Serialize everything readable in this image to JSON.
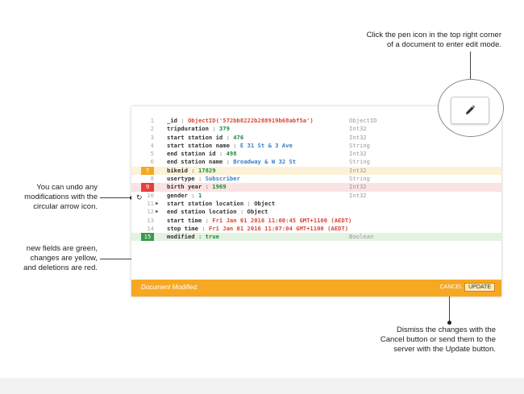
{
  "annotations": {
    "pen_tip": [
      "Click the pen icon in the top right corner",
      "of a document to enter edit mode."
    ],
    "undo_tip": [
      "You can undo any",
      "modifications with the",
      "circular arrow icon."
    ],
    "colors_tip": [
      "new fields are green,",
      "changes are yellow,",
      "and deletions are red."
    ],
    "buttons_tip": [
      "Dismiss the changes with the",
      "Cancel button or send them to the",
      "server with the Update button."
    ]
  },
  "document": {
    "rows": [
      {
        "line": "1",
        "key": "_id",
        "value": "ObjectID('572bb8222b288919b68abf5a')",
        "value_color": "red",
        "type": "ObjectID",
        "state": ""
      },
      {
        "line": "2",
        "key": "tripduration",
        "value": "379",
        "value_color": "green",
        "type": "Int32",
        "state": ""
      },
      {
        "line": "3",
        "key": "start station id",
        "value": "476",
        "value_color": "green",
        "type": "Int32",
        "state": ""
      },
      {
        "line": "4",
        "key": "start station name",
        "value": "E 31 St & 3 Ave",
        "value_color": "blue",
        "type": "String",
        "state": ""
      },
      {
        "line": "5",
        "key": "end station id",
        "value": "498",
        "value_color": "green",
        "type": "Int32",
        "state": ""
      },
      {
        "line": "6",
        "key": "end station name",
        "value": "Broadway & W 32 St",
        "value_color": "blue",
        "type": "String",
        "state": ""
      },
      {
        "line": "7",
        "key": "bikeid",
        "value": "17829",
        "value_color": "green",
        "type": "Int32",
        "state": "edited"
      },
      {
        "line": "8",
        "key": "usertype",
        "value": "Subscriber",
        "value_color": "blue",
        "type": "String",
        "state": ""
      },
      {
        "line": "9",
        "key": "birth year",
        "value": "1969",
        "value_color": "green",
        "type": "Int32",
        "state": "deleted"
      },
      {
        "line": "10",
        "key": "gender",
        "value": "1",
        "value_color": "green",
        "type": "Int32",
        "state": ""
      },
      {
        "line": "11",
        "key": "start station location",
        "value": "Object",
        "value_color": "plain",
        "type": "",
        "state": "",
        "expander": "▶"
      },
      {
        "line": "12",
        "key": "end station location",
        "value": "Object",
        "value_color": "plain",
        "type": "",
        "state": "",
        "expander": "▶"
      },
      {
        "line": "13",
        "key": "start time",
        "value": "Fri Jan 01 2016 11:00:45 GMT+1100 (AEDT)",
        "value_color": "red",
        "type": "",
        "state": ""
      },
      {
        "line": "14",
        "key": "stop time",
        "value": "Fri Jan 01 2016 11:07:04 GMT+1100 (AEDT)",
        "value_color": "red",
        "type": "",
        "state": ""
      },
      {
        "line": "15",
        "key": "modified",
        "value": "true",
        "value_color": "green",
        "type": "Boolean",
        "state": "added"
      }
    ],
    "footer": {
      "message": "Document Modified.",
      "cancel_label": "CANCEL",
      "update_label": "UPDATE"
    }
  },
  "icons": {
    "edit": "pen-icon",
    "undo": "undo-arrow-icon"
  },
  "colors": {
    "modified": "#f7a823",
    "deleted": "#e2403d",
    "added": "#3c9a4a"
  }
}
